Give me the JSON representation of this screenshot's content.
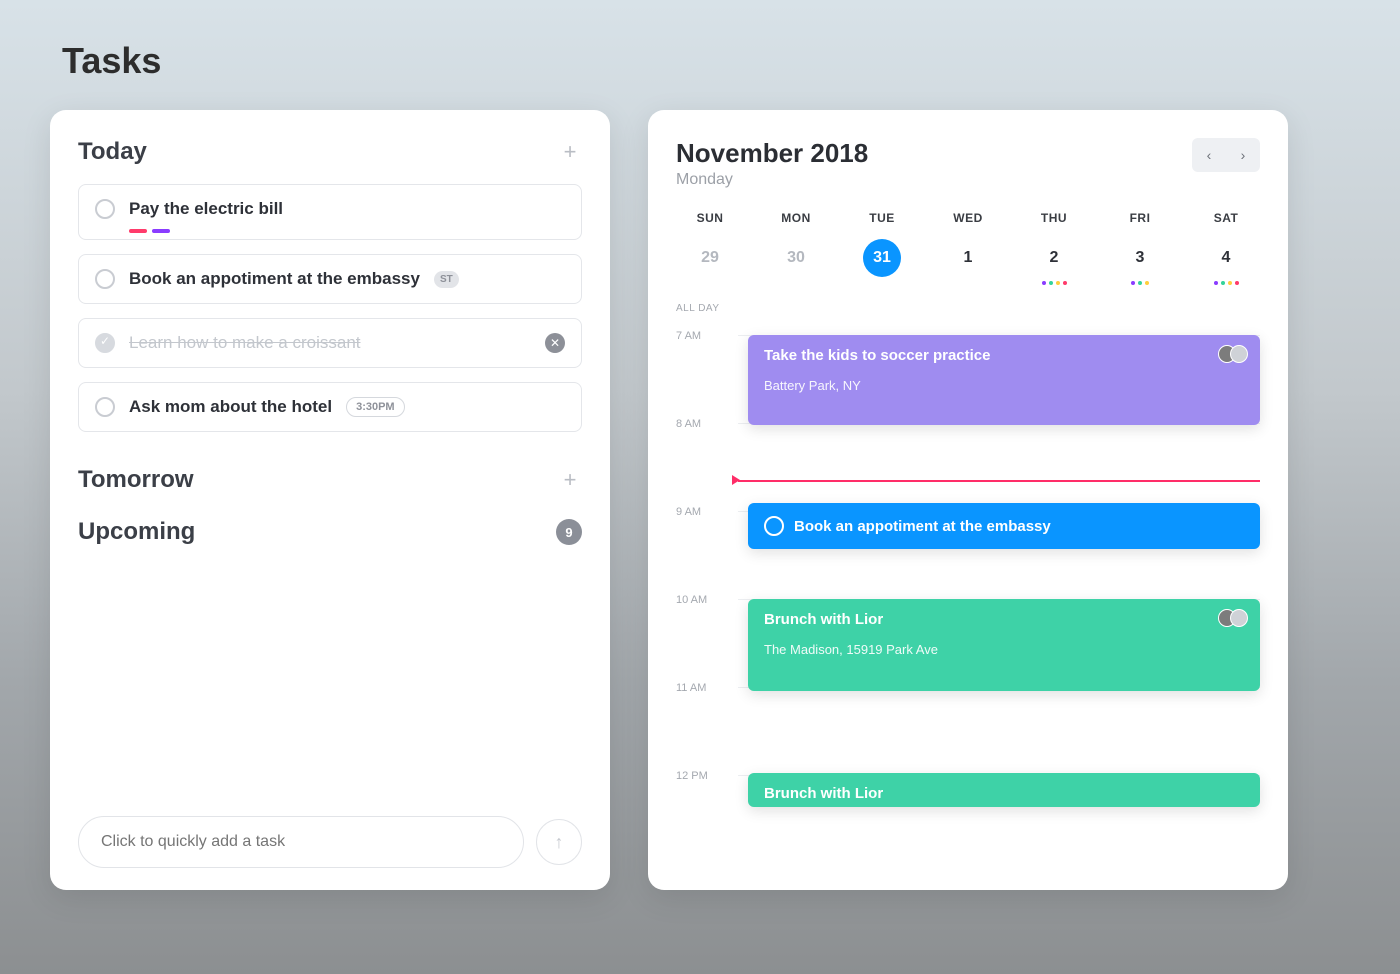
{
  "page": {
    "title": "Tasks"
  },
  "tasks": {
    "sections": {
      "today": {
        "title": "Today"
      },
      "tomorrow": {
        "title": "Tomorrow"
      },
      "upcoming": {
        "title": "Upcoming",
        "count": "9"
      }
    },
    "items": [
      {
        "text": "Pay the electric bill",
        "done": false,
        "tags": [
          "#ff3b6b",
          "#8a3cff"
        ]
      },
      {
        "text": "Book an appotiment at the embassy",
        "done": false,
        "badge": "ST"
      },
      {
        "text": "Learn how to make a croissant",
        "done": true
      },
      {
        "text": "Ask mom about the hotel",
        "done": false,
        "time_badge": "3:30PM"
      }
    ],
    "quick_add": {
      "placeholder": "Click to quickly add a task"
    }
  },
  "calendar": {
    "title": "November 2018",
    "subtitle": "Monday",
    "dow": [
      "SUN",
      "MON",
      "TUE",
      "WED",
      "THU",
      "FRI",
      "SAT"
    ],
    "days": [
      {
        "num": "29",
        "muted": true
      },
      {
        "num": "30",
        "muted": true
      },
      {
        "num": "31",
        "selected": true
      },
      {
        "num": "1"
      },
      {
        "num": "2",
        "dots": [
          "#8a3cff",
          "#34d39b",
          "#ffcf3d",
          "#ff3b6b"
        ]
      },
      {
        "num": "3",
        "dots": [
          "#8a3cff",
          "#34d39b",
          "#ffcf3d"
        ]
      },
      {
        "num": "4",
        "dots": [
          "#8a3cff",
          "#34d39b",
          "#ffcf3d",
          "#ff3b6b"
        ]
      }
    ],
    "allday_label": "ALL DAY",
    "hours": [
      "7 AM",
      "8 AM",
      "9 AM",
      "10 AM",
      "11 AM",
      "12 PM"
    ],
    "events": [
      {
        "title": "Take the kids to soccer practice",
        "location": "Battery Park, NY",
        "color": "#9f8cf0",
        "avatars": [
          "#7c7c7c",
          "#cfd2d7"
        ]
      },
      {
        "title": "Book an appotiment at the embassy",
        "color": "#0a95ff",
        "ring": true
      },
      {
        "title": "Brunch with Lior",
        "location": "The Madison, 15919 Park Ave",
        "color": "#3ed2a7",
        "avatars": [
          "#7c7c7c",
          "#cfd2d7"
        ]
      },
      {
        "title": "Brunch with Lior",
        "color": "#3ed2a7"
      }
    ]
  }
}
